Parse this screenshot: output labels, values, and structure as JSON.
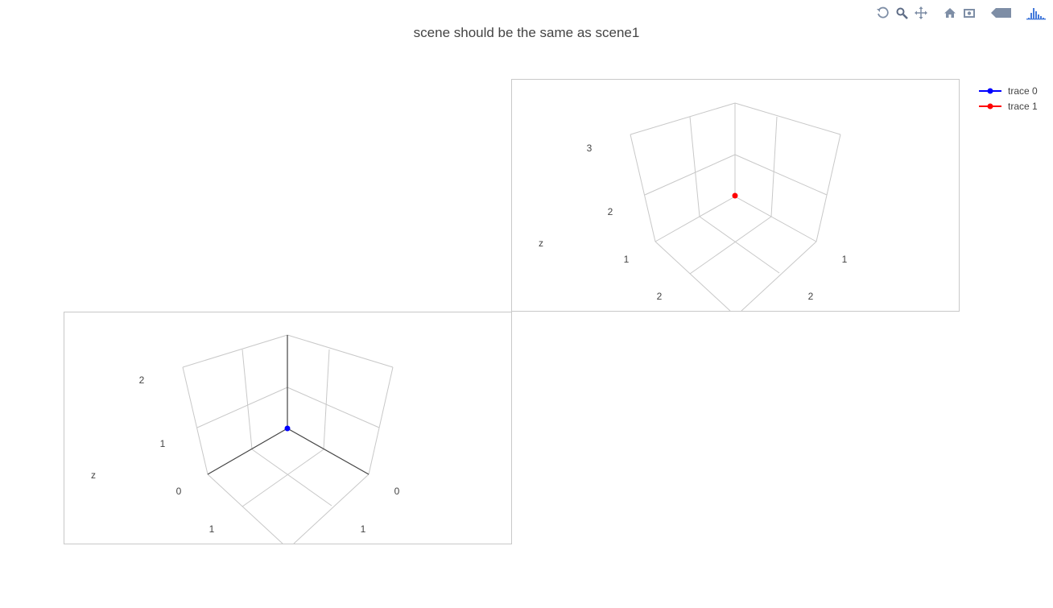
{
  "title": "scene should be the same as scene1",
  "modebar": {
    "icons": [
      "undo-icon",
      "zoom-icon",
      "pan-icon",
      "home-icon",
      "camera-icon",
      "tag-icon",
      "plotly-logo"
    ]
  },
  "legend": {
    "items": [
      {
        "label": "trace 0",
        "color": "#0000ff"
      },
      {
        "label": "trace 1",
        "color": "#ff0000"
      }
    ]
  },
  "chart_data": [
    {
      "type": "scatter3d",
      "scene": "scene1",
      "title": "",
      "z_axis_label": "z",
      "z_ticks": [
        "0",
        "1",
        "2"
      ],
      "x_ticks": [
        "0",
        "1"
      ],
      "y_ticks": [
        "0",
        "1"
      ],
      "series": [
        {
          "name": "trace 0",
          "color": "#0000ff",
          "points": [
            {
              "x": 0,
              "y": 0,
              "z": 0
            }
          ]
        }
      ]
    },
    {
      "type": "scatter3d",
      "scene": "scene",
      "title": "",
      "z_axis_label": "z",
      "z_ticks": [
        "1",
        "2",
        "3"
      ],
      "x_ticks": [
        "1",
        "2"
      ],
      "y_ticks": [
        "1",
        "2"
      ],
      "series": [
        {
          "name": "trace 1",
          "color": "#ff0000",
          "points": [
            {
              "x": 1,
              "y": 1,
              "z": 1
            }
          ]
        }
      ]
    }
  ]
}
